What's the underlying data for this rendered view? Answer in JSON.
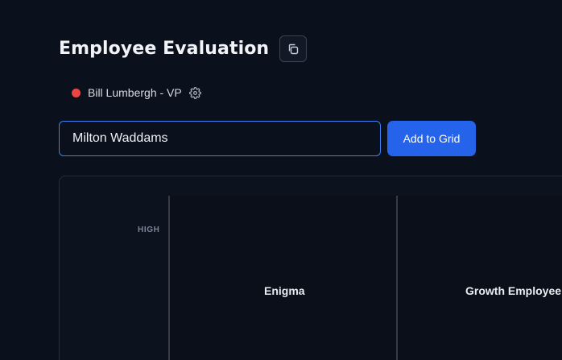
{
  "header": {
    "title": "Employee Evaluation",
    "copy_icon": "copy-icon"
  },
  "user": {
    "name": "Bill Lumbergh - VP",
    "status_color": "#ef4444",
    "settings_icon": "gear-icon"
  },
  "employee_input": {
    "value": "Milton Waddams",
    "placeholder": ""
  },
  "add_button": {
    "label": "Add to Grid",
    "color": "#2563eb"
  },
  "grid": {
    "y_axis_high": "HIGH",
    "cells": [
      {
        "label": "Enigma"
      },
      {
        "label": "Growth Employee"
      }
    ]
  }
}
